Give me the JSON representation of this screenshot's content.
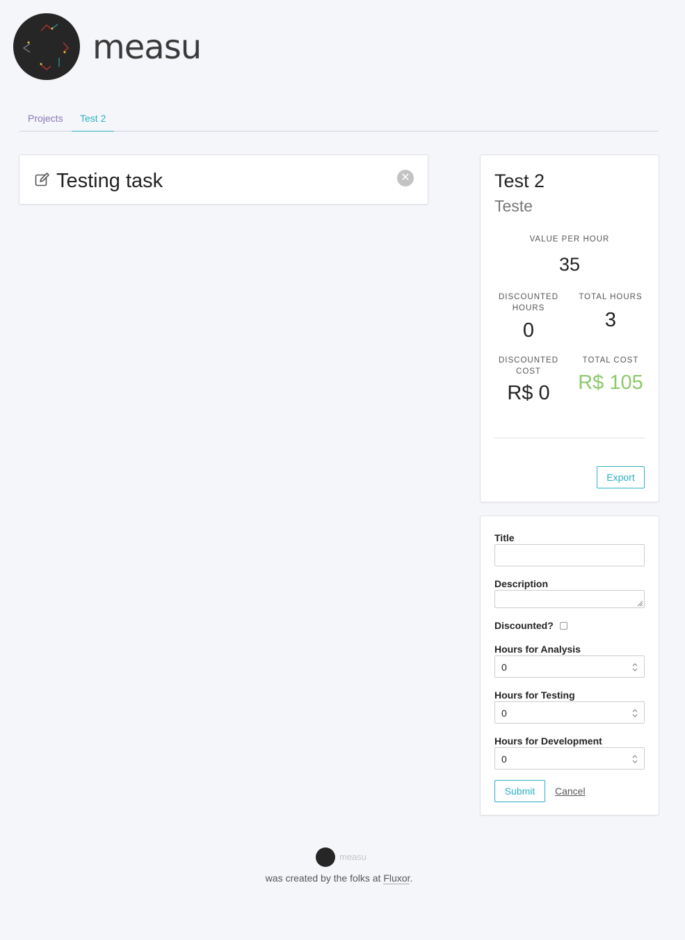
{
  "header": {
    "brand": "measu",
    "logo": "measu-logo-icon"
  },
  "tabs": [
    {
      "label": "Projects",
      "active": false
    },
    {
      "label": "Test 2",
      "active": true
    }
  ],
  "task": {
    "title": "Testing task",
    "edit_icon": "edit-icon",
    "close_icon": "close-icon"
  },
  "summary": {
    "title": "Test 2",
    "subtitle": "Teste",
    "value_per_hour_label": "VALUE PER HOUR",
    "value_per_hour": "35",
    "discounted_hours_label": "DISCOUNTED HOURS",
    "discounted_hours": "0",
    "total_hours_label": "TOTAL HOURS",
    "total_hours": "3",
    "discounted_cost_label": "DISCOUNTED COST",
    "discounted_cost": "R$ 0",
    "total_cost_label": "TOTAL COST",
    "total_cost": "R$ 105",
    "total_cost_color": "#8dc96b",
    "export_label": "Export"
  },
  "form": {
    "title_label": "Title",
    "title_value": "",
    "description_label": "Description",
    "discounted_label": "Discounted?",
    "discounted_checked": false,
    "hours_analysis_label": "Hours for Analysis",
    "hours_analysis": "0",
    "hours_testing_label": "Hours for Testing",
    "hours_testing": "0",
    "hours_development_label": "Hours for Development",
    "hours_development": "0",
    "submit_label": "Submit",
    "cancel_label": "Cancel"
  },
  "footer": {
    "brand": "measu",
    "text_before": "was created by the folks at ",
    "link": "Fluxor",
    "text_after": "."
  },
  "colors": {
    "accent": "#2bb0c4",
    "projects_tab": "#8a76b3",
    "background": "#f5f6fa"
  }
}
